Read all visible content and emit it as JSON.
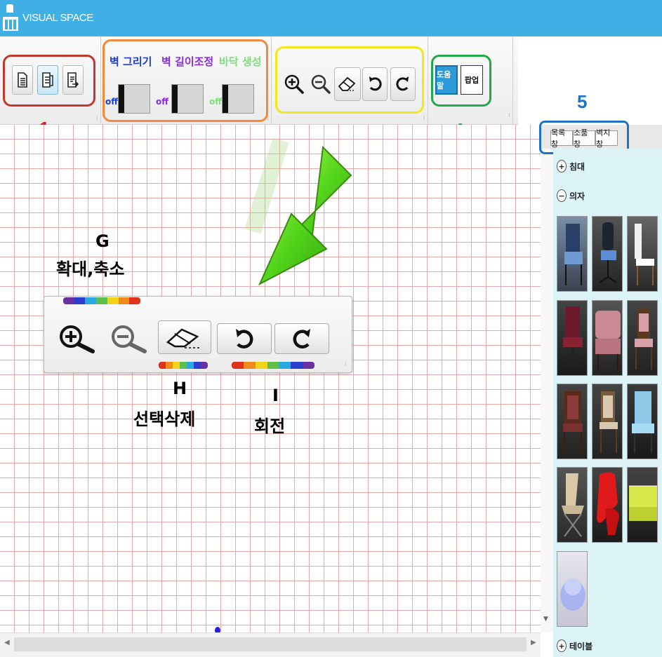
{
  "app": {
    "title": "VISUAL SPACE"
  },
  "colors": {
    "titlebar": "#3fb0e6",
    "group1": "#c0392b",
    "group2": "#f08a3c",
    "group3": "#f2e61d",
    "group4": "#22a84a",
    "group5": "#1f72c4"
  },
  "toolbar": {
    "group1": {
      "number": "1",
      "buttons": [
        "new-file-icon",
        "edit-file-icon",
        "export-file-icon"
      ]
    },
    "group2": {
      "number": "2",
      "toggles": [
        {
          "label": "벽 그리기",
          "state": "off",
          "color": "#1a3cd8"
        },
        {
          "label": "벽 길이조정",
          "state": "off",
          "color": "#8a2be2"
        },
        {
          "label": "바닥 생성",
          "state": "off",
          "color": "#7fdc7f"
        }
      ]
    },
    "group3": {
      "number": "3",
      "buttons": [
        "zoom-in-icon",
        "zoom-out-icon",
        "eraser-icon",
        "rotate-left-icon",
        "rotate-right-icon"
      ]
    },
    "group4": {
      "number": "4",
      "buttons": [
        {
          "label": "도움말",
          "active": true
        },
        {
          "label": "팝업",
          "active": false
        }
      ]
    }
  },
  "sidebar": {
    "number": "5",
    "tabs": [
      "목록창",
      "소품창",
      "벽지창"
    ],
    "tree": [
      {
        "toggle": "+",
        "label": "침대"
      },
      {
        "toggle": "−",
        "label": "의자"
      }
    ],
    "tree_bottom": {
      "toggle": "+",
      "label": "테이블"
    },
    "chair_thumbnails": 13
  },
  "callout": {
    "labels": {
      "g_letter": "G",
      "g_text": "확대,축소",
      "h_letter": "H",
      "h_text": "선택삭제",
      "i_letter": "I",
      "i_text": "회전"
    }
  }
}
